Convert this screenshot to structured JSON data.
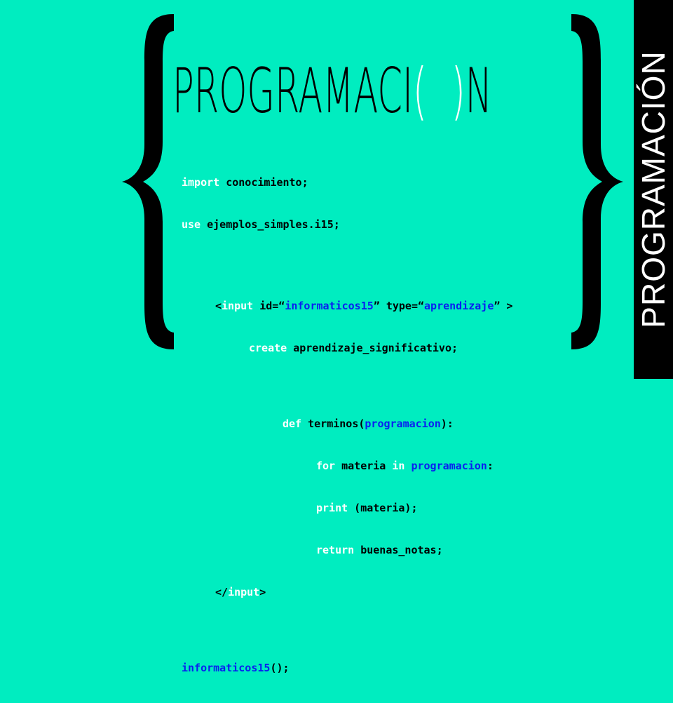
{
  "colors": {
    "background": "#00EDC0",
    "keyword": "#FFFFFF",
    "string": "#0A1FF0",
    "text": "#000000",
    "side_panel": "#000000"
  },
  "title": {
    "before": "PROGRAMACI",
    "open_paren": "(",
    "close_paren": ")",
    "after": "N"
  },
  "side_label": "PROGRAMACIÓN",
  "code": {
    "l1": {
      "kw": "import",
      "rest": " conocimiento;"
    },
    "l2": {
      "kw": "use",
      "rest": " ejemplos_simples.i15;"
    },
    "l3": {
      "p1": "<",
      "tag": "input",
      "p2": " id=“",
      "val1": "informaticos15",
      "p3": "” type=“",
      "val2": "aprendizaje",
      "p4": "” >"
    },
    "l4": {
      "kw": "create",
      "rest": " aprendizaje_significativo;"
    },
    "l5": {
      "kw": "def",
      "p1": " terminos(",
      "arg": "programacion",
      "p2": "):"
    },
    "l6": {
      "kw1": "for",
      "p1": " materia ",
      "kw2": "in",
      "p2": " ",
      "arg": "programacion",
      "p3": ":"
    },
    "l7": {
      "kw": "print",
      "rest": " (materia);"
    },
    "l8": {
      "kw": "return",
      "rest": " buenas_notas;"
    },
    "l9": {
      "p1": "</",
      "tag": "input",
      "p2": ">"
    },
    "l10": {
      "name": "informaticos15",
      "rest": "();"
    }
  }
}
